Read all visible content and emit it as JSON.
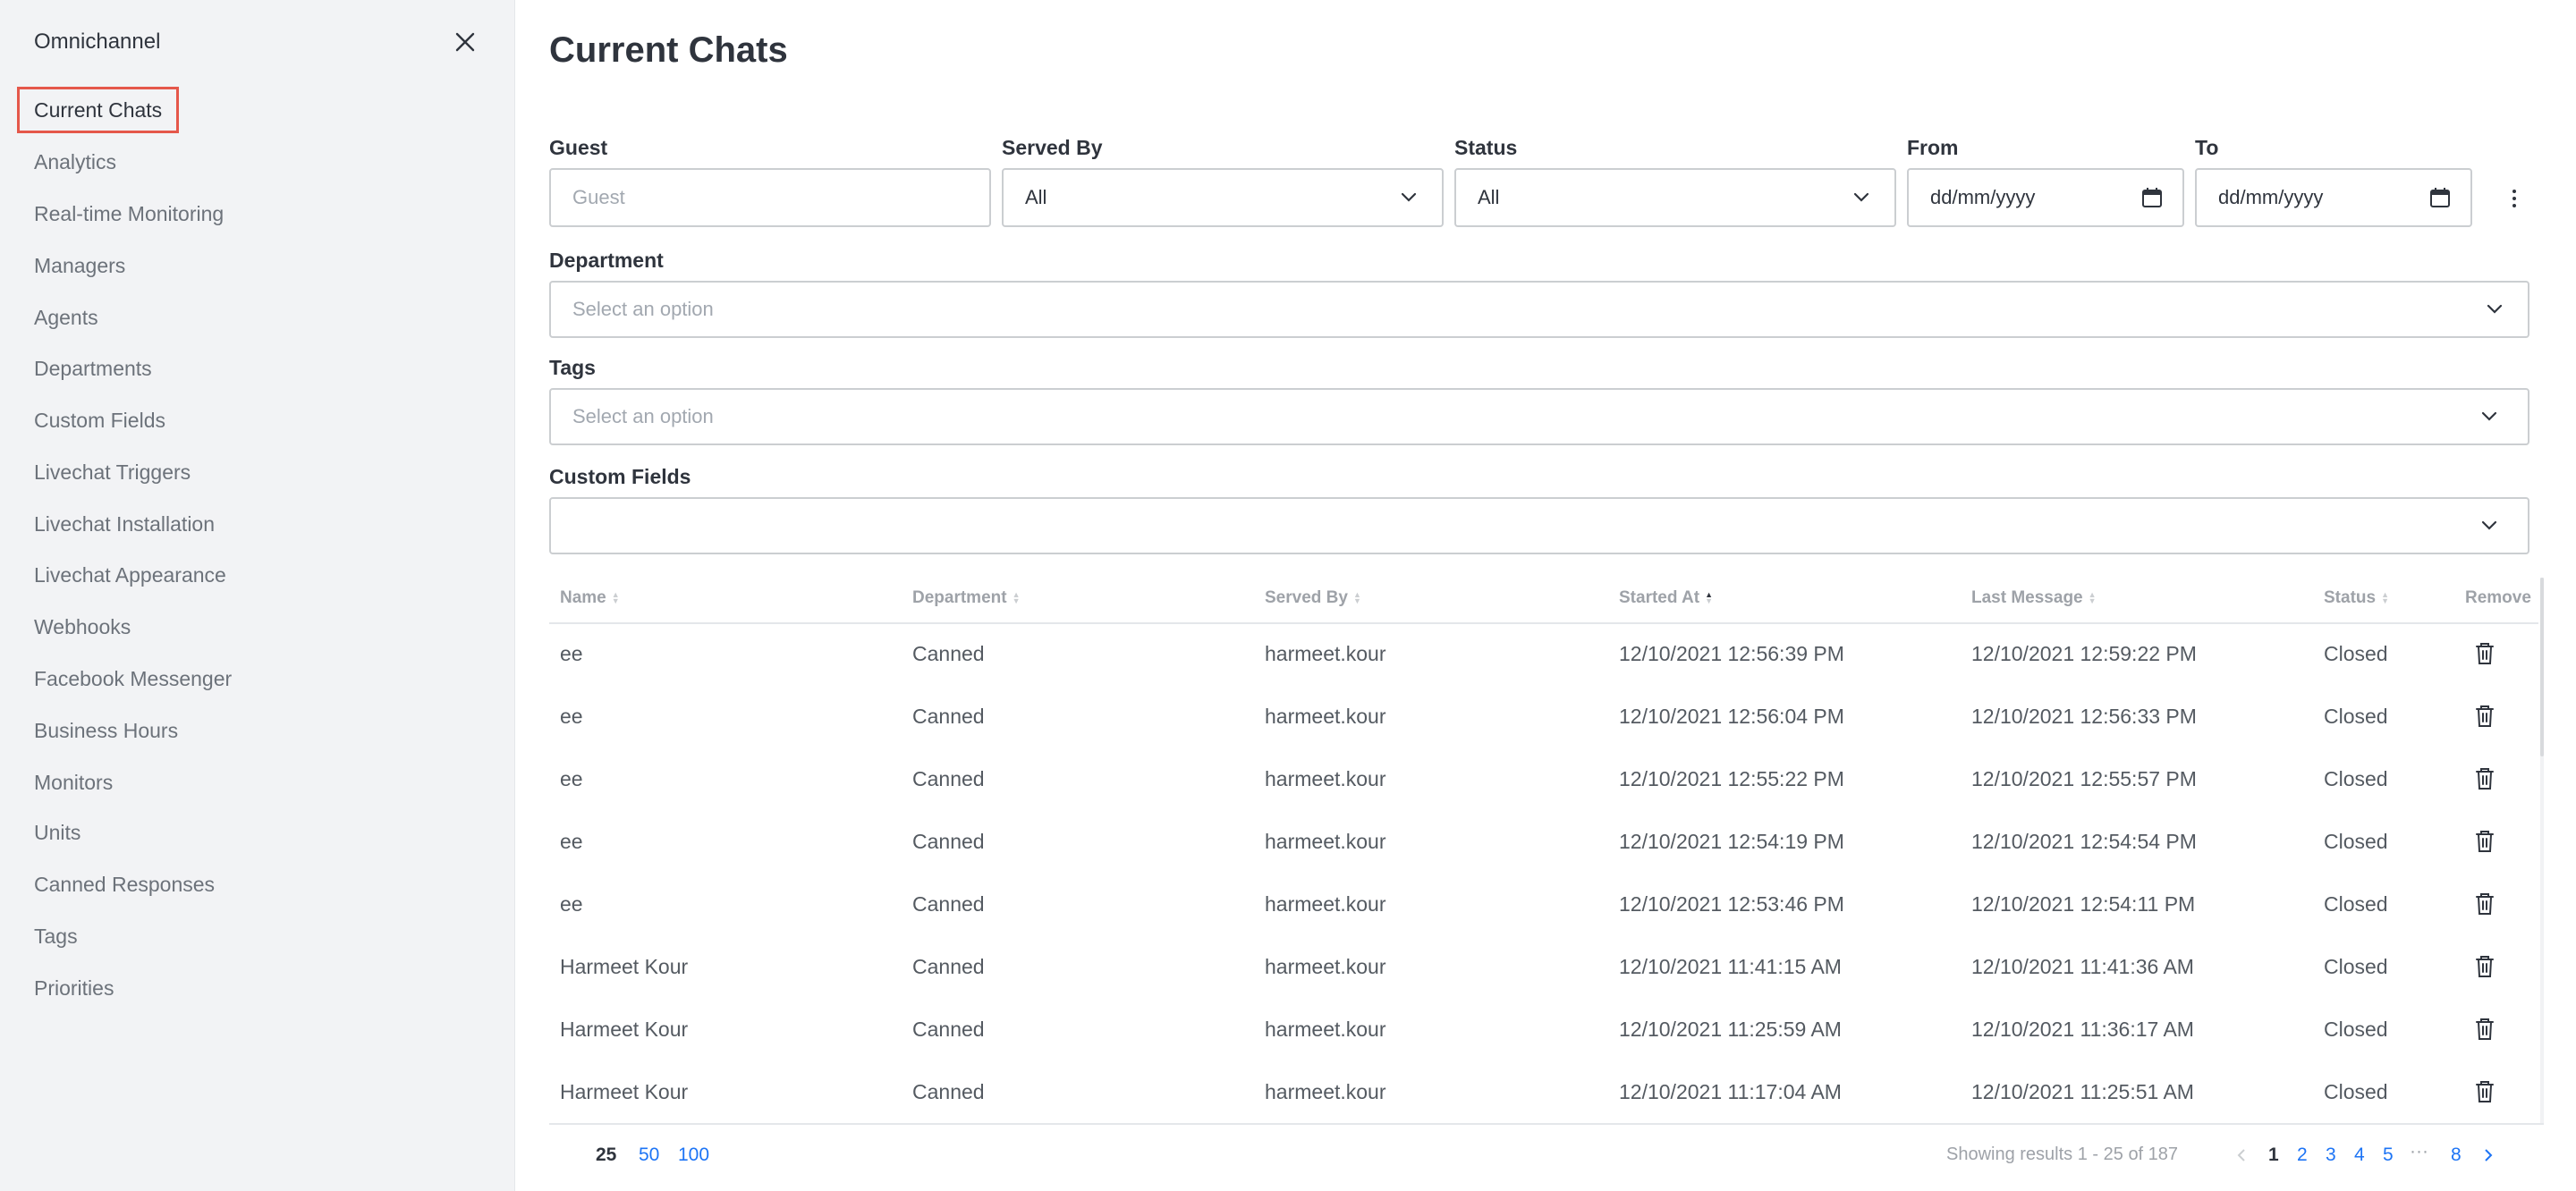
{
  "sidebar": {
    "title": "Omnichannel",
    "items": [
      {
        "label": "Current Chats"
      },
      {
        "label": "Analytics"
      },
      {
        "label": "Real-time Monitoring"
      },
      {
        "label": "Managers"
      },
      {
        "label": "Agents"
      },
      {
        "label": "Departments"
      },
      {
        "label": "Custom Fields"
      },
      {
        "label": "Livechat Triggers"
      },
      {
        "label": "Livechat Installation"
      },
      {
        "label": "Livechat Appearance"
      },
      {
        "label": "Webhooks"
      },
      {
        "label": "Facebook Messenger"
      },
      {
        "label": "Business Hours"
      },
      {
        "label": "Monitors"
      },
      {
        "label": "Units"
      },
      {
        "label": "Canned Responses"
      },
      {
        "label": "Tags"
      },
      {
        "label": "Priorities"
      }
    ]
  },
  "main": {
    "title": "Current Chats",
    "filters": {
      "guest_label": "Guest",
      "guest_placeholder": "Guest",
      "served_by_label": "Served By",
      "served_by_value": "All",
      "status_label": "Status",
      "status_value": "All",
      "from_label": "From",
      "from_value": "dd/mm/yyyy",
      "to_label": "To",
      "to_value": "dd/mm/yyyy",
      "department_label": "Department",
      "department_placeholder": "Select an option",
      "tags_label": "Tags",
      "tags_placeholder": "Select an option",
      "custom_fields_label": "Custom Fields"
    },
    "table": {
      "headers": {
        "name": "Name",
        "department": "Department",
        "served_by": "Served By",
        "started_at": "Started At",
        "last_message": "Last Message",
        "status": "Status",
        "remove": "Remove"
      },
      "rows": [
        {
          "name": "ee",
          "department": "Canned",
          "served_by": "harmeet.kour",
          "started_at": "12/10/2021 12:56:39 PM",
          "last_message": "12/10/2021 12:59:22 PM",
          "status": "Closed"
        },
        {
          "name": "ee",
          "department": "Canned",
          "served_by": "harmeet.kour",
          "started_at": "12/10/2021 12:56:04 PM",
          "last_message": "12/10/2021 12:56:33 PM",
          "status": "Closed"
        },
        {
          "name": "ee",
          "department": "Canned",
          "served_by": "harmeet.kour",
          "started_at": "12/10/2021 12:55:22 PM",
          "last_message": "12/10/2021 12:55:57 PM",
          "status": "Closed"
        },
        {
          "name": "ee",
          "department": "Canned",
          "served_by": "harmeet.kour",
          "started_at": "12/10/2021 12:54:19 PM",
          "last_message": "12/10/2021 12:54:54 PM",
          "status": "Closed"
        },
        {
          "name": "ee",
          "department": "Canned",
          "served_by": "harmeet.kour",
          "started_at": "12/10/2021 12:53:46 PM",
          "last_message": "12/10/2021 12:54:11 PM",
          "status": "Closed"
        },
        {
          "name": "Harmeet Kour",
          "department": "Canned",
          "served_by": "harmeet.kour",
          "started_at": "12/10/2021 11:41:15 AM",
          "last_message": "12/10/2021 11:41:36 AM",
          "status": "Closed"
        },
        {
          "name": "Harmeet Kour",
          "department": "Canned",
          "served_by": "harmeet.kour",
          "started_at": "12/10/2021 11:25:59 AM",
          "last_message": "12/10/2021 11:36:17 AM",
          "status": "Closed"
        },
        {
          "name": "Harmeet Kour",
          "department": "Canned",
          "served_by": "harmeet.kour",
          "started_at": "12/10/2021 11:17:04 AM",
          "last_message": "12/10/2021 11:25:51 AM",
          "status": "Closed"
        }
      ]
    },
    "pagination": {
      "per_page": [
        "25",
        "50",
        "100"
      ],
      "results_text": "Showing results 1 - 25 of 187",
      "pages": [
        "1",
        "2",
        "3",
        "4",
        "5"
      ],
      "ellipsis": "···",
      "last_page": "8"
    }
  }
}
